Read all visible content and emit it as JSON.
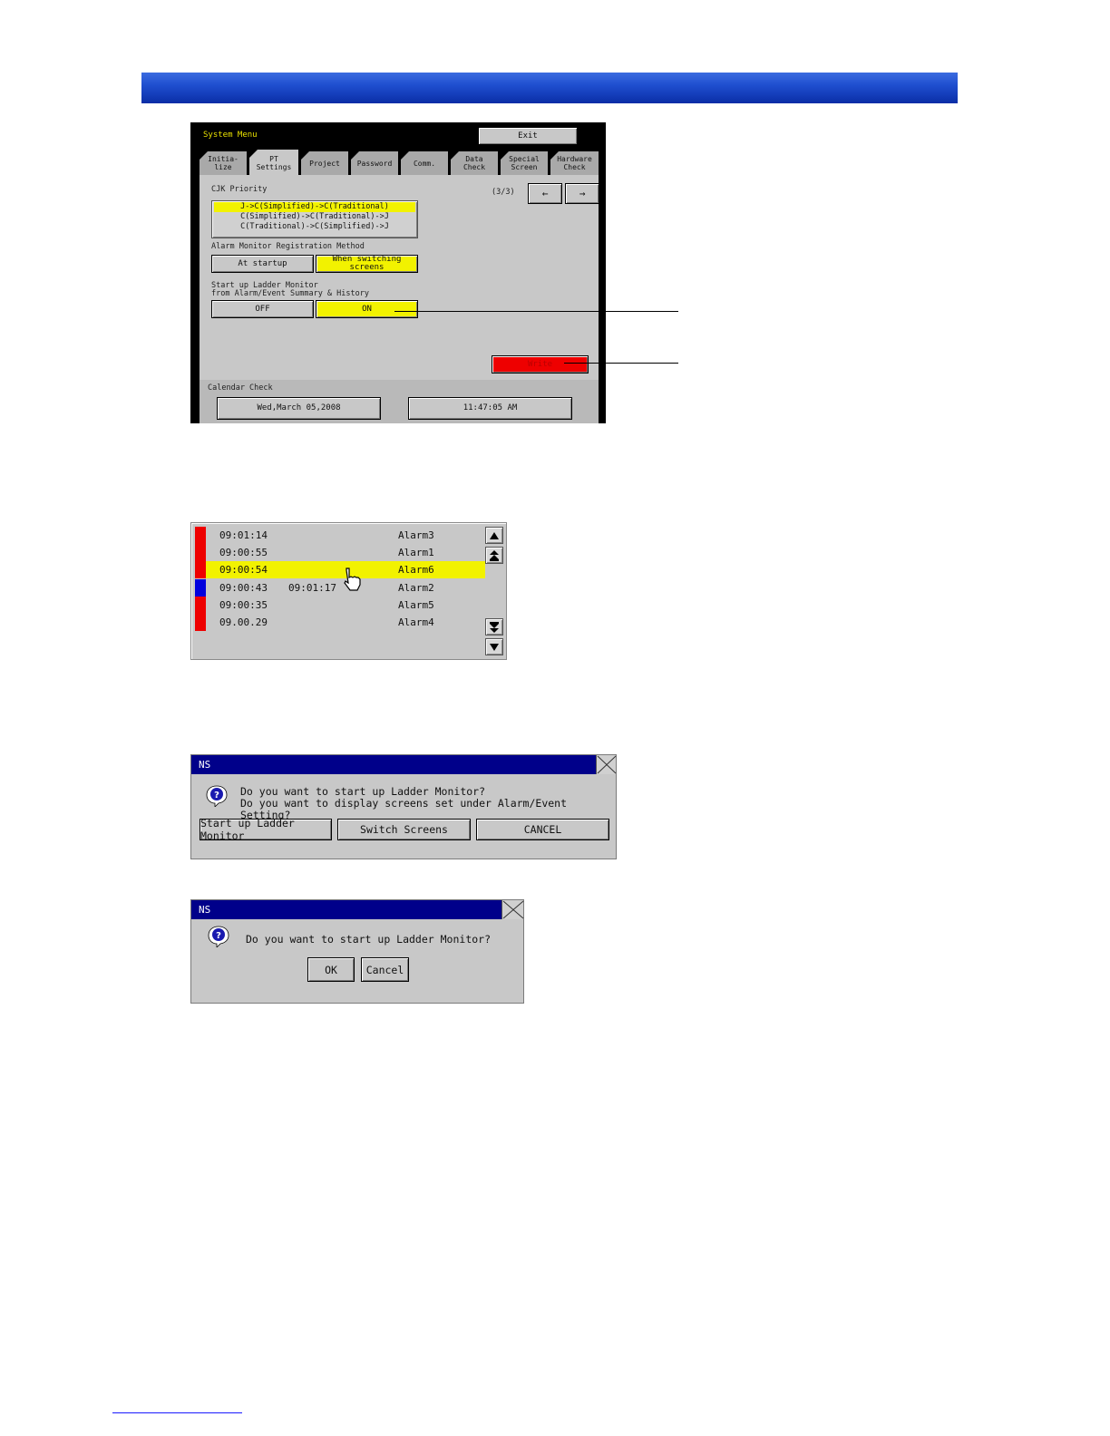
{
  "system_menu": {
    "title": "System Menu",
    "exit_label": "Exit",
    "tabs": [
      {
        "label": "Initia-\nlize"
      },
      {
        "label": "PT\nSettings"
      },
      {
        "label": "Project"
      },
      {
        "label": "Password"
      },
      {
        "label": "Comm."
      },
      {
        "label": "Data\nCheck"
      },
      {
        "label": "Special\nScreen"
      },
      {
        "label": "Hardware\nCheck"
      }
    ],
    "page_indicator": "(3/3)",
    "prev_label": "←",
    "next_label": "→",
    "cjk_priority_label": "CJK Priority",
    "cjk_options": [
      "J->C(Simplified)->C(Traditional)",
      "C(Simplified)->C(Traditional)->J",
      "C(Traditional)->C(Simplified)->J"
    ],
    "alarm_method_label": "Alarm Monitor Registration Method",
    "at_startup_label": "At startup",
    "when_switching_label": "When switching screens",
    "ladder_label": "Start up Ladder Monitor\nfrom Alarm/Event Summary & History",
    "off_label": "OFF",
    "on_label": "ON",
    "write_label": "Write",
    "calendar_label": "Calendar Check",
    "date_value": "Wed,March 05,2008",
    "time_value": "11:47:05 AM"
  },
  "alarm_list": {
    "rows": [
      {
        "time": "09:01:14",
        "time2": "",
        "name": "Alarm3",
        "color": "#ee0000"
      },
      {
        "time": "09:00:55",
        "time2": "",
        "name": "Alarm1",
        "color": "#ee0000"
      },
      {
        "time": "09:00:54",
        "time2": "",
        "name": "Alarm6",
        "color": "#ee0000"
      },
      {
        "time": "09:00:43",
        "time2": "09:01:17",
        "name": "Alarm2",
        "color": "#0000dd"
      },
      {
        "time": "09:00:35",
        "time2": "",
        "name": "Alarm5",
        "color": "#ee0000"
      },
      {
        "time": "09.00.29",
        "time2": "",
        "name": "Alarm4",
        "color": "#ee0000"
      }
    ]
  },
  "dialog1": {
    "title": "NS",
    "message": "Do you want to start up Ladder Monitor?\nDo you want to display screens set under Alarm/Event Setting?",
    "btn_ladder": "Start up Ladder Monitor",
    "btn_switch": "Switch Screens",
    "btn_cancel": "CANCEL"
  },
  "dialog2": {
    "title": "NS",
    "message": "Do you want to start up Ladder Monitor?",
    "btn_ok": "OK",
    "btn_cancel": "Cancel"
  },
  "colors": {
    "header_blue": "#1f4fd0",
    "highlight_yellow": "#f2f200",
    "write_red": "#ee0000",
    "dialog_title_blue": "#00008a"
  }
}
